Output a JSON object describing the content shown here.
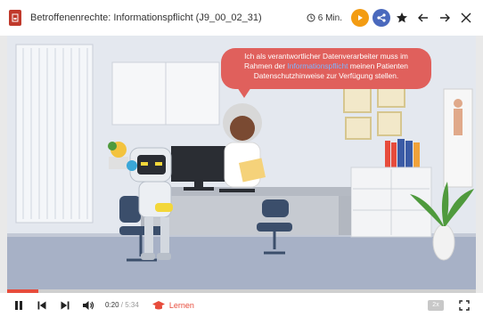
{
  "header": {
    "title": "Betroffenenrechte: Informationspflicht (J9_00_02_31)",
    "duration": "6 Min."
  },
  "bubble": {
    "line1": "Ich als verantwortlicher Datenverarbeiter muss im",
    "line2_pre": "Rahmen der ",
    "line2_highlight": "Informationspflicht",
    "line2_post": " meinen Patienten",
    "line3": "Datenschutzhinweise zur Verfügung stellen."
  },
  "player": {
    "current_time": "0:20",
    "separator": " / ",
    "total_time": "5:34",
    "progress_fraction": 0.066,
    "learn_label": "Lernen",
    "speed_label": "2x"
  },
  "colors": {
    "accent": "#e74c3c",
    "play_circle": "#f39c12",
    "share_circle": "#4a69bd",
    "bubble": "#e0605c",
    "highlight": "#7eb6ff"
  },
  "icons": [
    "document-icon",
    "clock-icon",
    "play-circle-icon",
    "share-icon",
    "star-icon",
    "arrow-left-icon",
    "arrow-right-icon",
    "close-icon",
    "pause-icon",
    "skip-back-icon",
    "skip-forward-icon",
    "volume-icon",
    "graduation-cap-icon",
    "fullscreen-icon"
  ]
}
